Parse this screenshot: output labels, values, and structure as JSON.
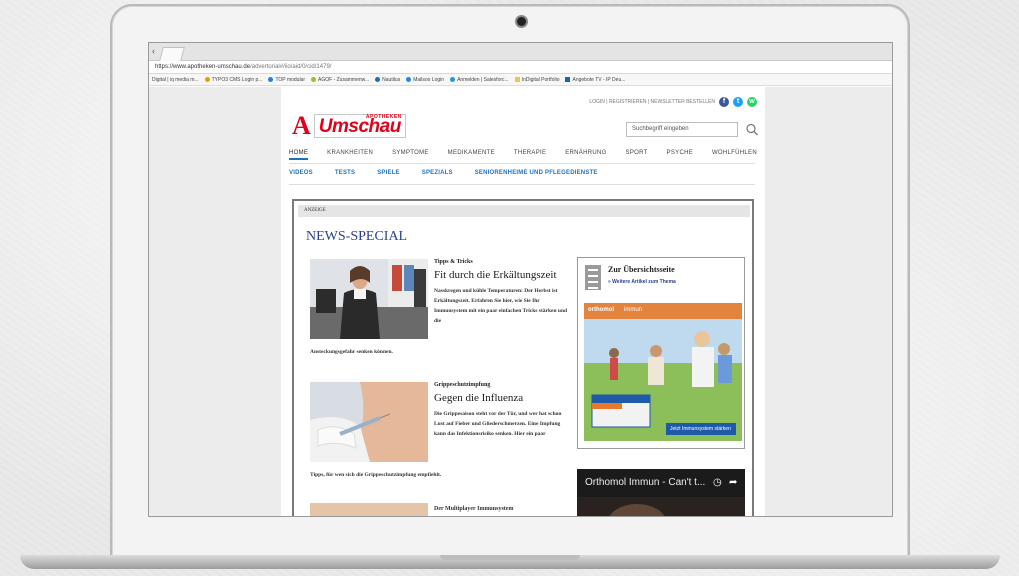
{
  "browser": {
    "url_host": "https://www.apotheken-umschau.de",
    "url_path": "/advertorial#/iio/aid/0/cid/1479/",
    "bookmarks": [
      {
        "label": "Digital | iq media m...",
        "icon": "none",
        "color": ""
      },
      {
        "label": "TYPO3 CMS Login p...",
        "icon": "typo3-icon",
        "color": "#f49700"
      },
      {
        "label": "TOP modular",
        "icon": "top-icon",
        "color": "#2a7fd4"
      },
      {
        "label": "AGOF - Zusammenw...",
        "icon": "agof-icon",
        "color": "#9bbf2f"
      },
      {
        "label": "Nautilus",
        "icon": "nautilus-icon",
        "color": "#1e6bb8"
      },
      {
        "label": "Mailsoo Login",
        "icon": "mail-icon",
        "color": "#1e88e5"
      },
      {
        "label": "Anmelden | Salesforc...",
        "icon": "salesforce-icon",
        "color": "#1f9ad6"
      },
      {
        "label": "InDigital Portfolio",
        "icon": "folder-icon",
        "color": "#f4c542"
      },
      {
        "label": "Angebote TV - IP Deu...",
        "icon": "tv-icon",
        "color": "#1565c0"
      }
    ]
  },
  "header": {
    "toplinks": "LOGIN | REGISTRIEREN | NEWSLETTER BESTELLEN",
    "logo_super": "APOTHEKEN",
    "logo_word": "Umschau",
    "logo_mark": "A",
    "search_placeholder": "Suchbegriff eingeben",
    "social": {
      "facebook": "f",
      "twitter": "t",
      "whatsapp": "w"
    },
    "brand_color": "#e2001a"
  },
  "nav": {
    "main": [
      "HOME",
      "KRANKHEITEN",
      "SYMPTOME",
      "MEDIKAMENTE",
      "THERAPIE",
      "ERNÄHRUNG",
      "SPORT",
      "PSYCHE",
      "WOHLFÜHLEN"
    ],
    "active_index": 0,
    "sub": [
      "VIDEOS",
      "TESTS",
      "SPIELE",
      "SPEZIALS",
      "SENIORENHEIME UND PFLEGEDIENSTE"
    ]
  },
  "ad": {
    "label": "ANZEIGE",
    "section_title": "NEWS-SPECIAL",
    "articles": [
      {
        "kicker": "Tipps & Tricks",
        "headline": "Fit durch die Erkältungszeit",
        "teaser": "Nasskregen und kühle Temperaturen: Der Herbst ist Erkältungszeit. Erfahren Sie hier, wie Sie Ihr Immunsystem mit ein paar einfachen Tricks stärken und die",
        "teaser_tail": "Ansteckungsgefahr senken können."
      },
      {
        "kicker": "Grippeschutzimpfung",
        "headline": "Gegen die Influenza",
        "teaser": "Die Grippesaison steht vor der Tür, und wer hat schon Lust auf Fieber und Gliederschmerzen. Eine Impfung kann das Infektionsrisiko senken. Hier ein paar",
        "teaser_tail": "Tipps, für wen sich die Grippeschutzimpfung empfiehlt."
      },
      {
        "kicker": "",
        "headline": "Der Multiplayer Immunsystem",
        "teaser": "",
        "teaser_tail": ""
      }
    ],
    "sidebar": {
      "title": "Zur Übersichtsseite",
      "link": "» Weitere Artikel zum Thema",
      "product_brand": "orthomol",
      "product_name": "immun",
      "product_cta": "Jetzt Immunsystem stärken"
    },
    "video": {
      "title": "Orthomol Immun - Can't t..."
    }
  }
}
